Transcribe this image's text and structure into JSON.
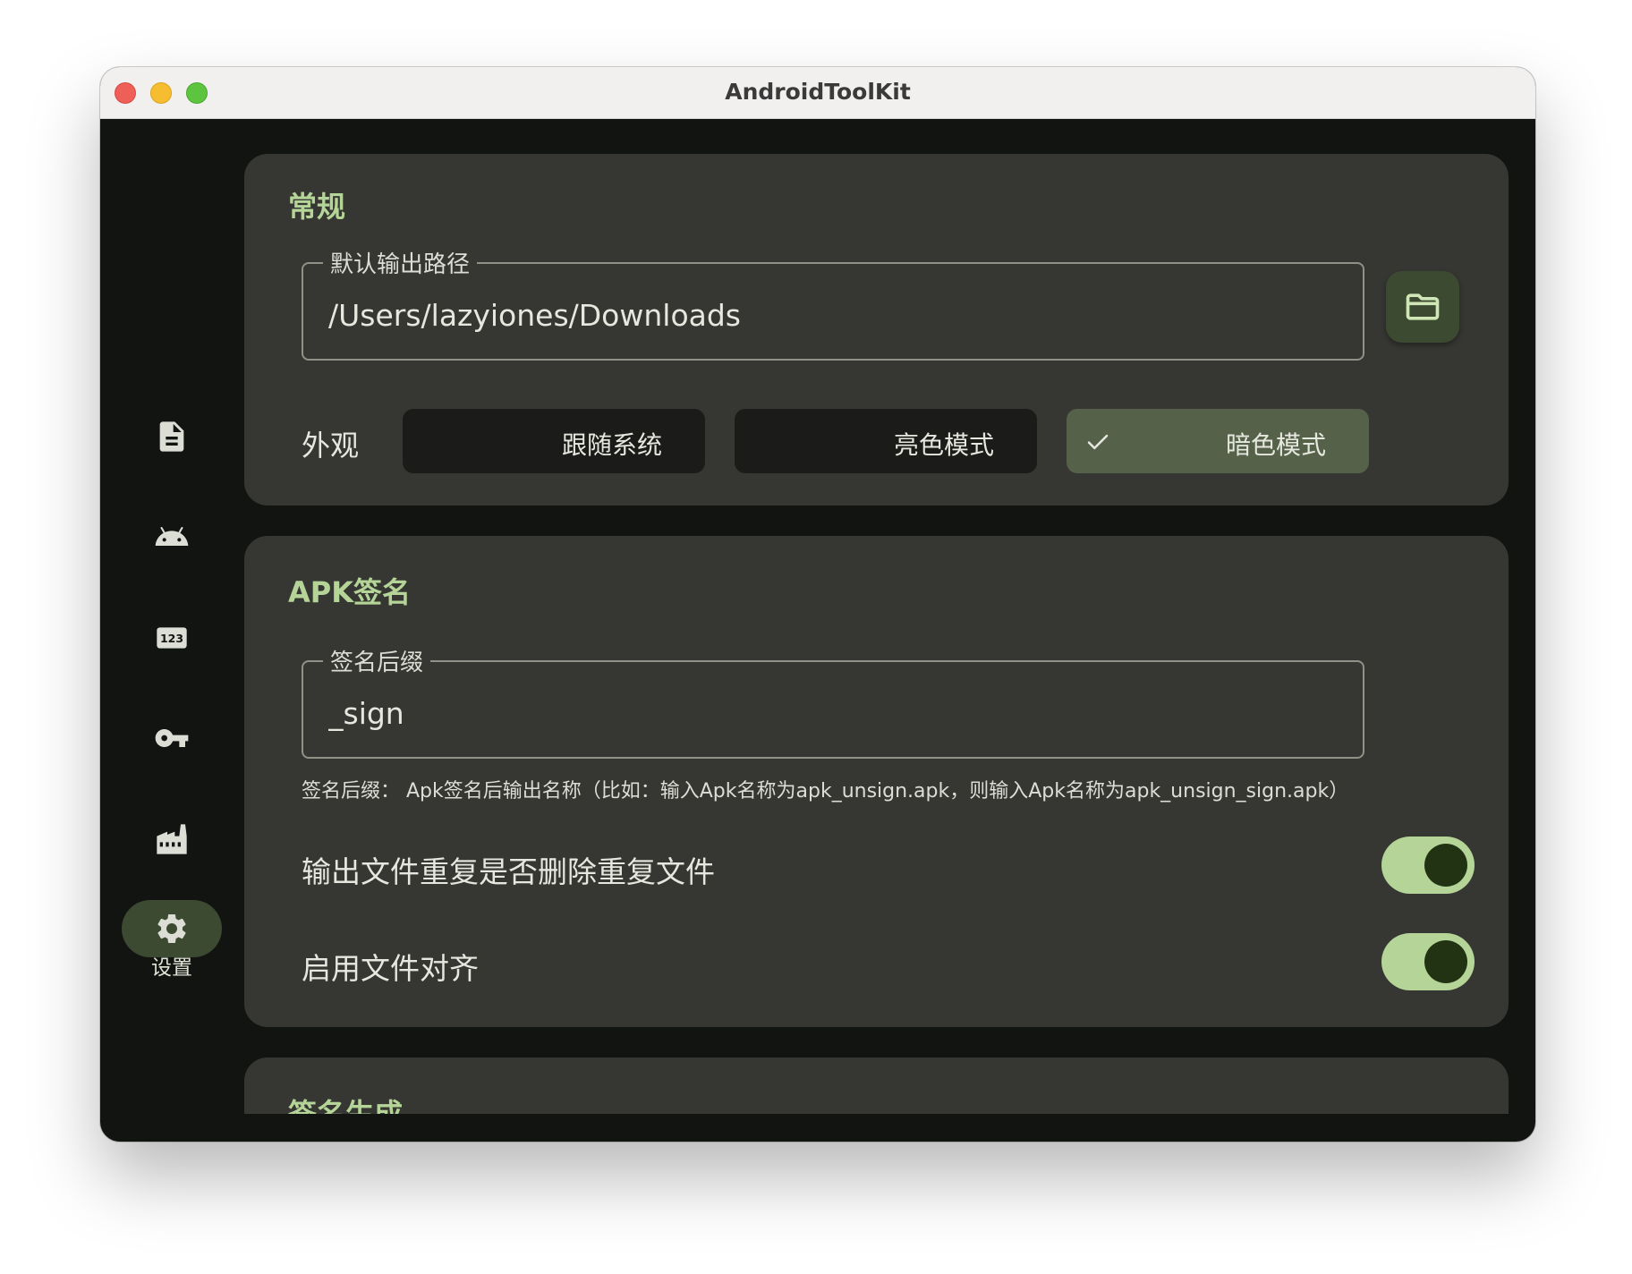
{
  "window": {
    "title": "AndroidToolKit"
  },
  "sidebar": {
    "items": [
      {
        "icon": "document-icon"
      },
      {
        "icon": "android-icon"
      },
      {
        "icon": "numbers-123-icon"
      },
      {
        "icon": "key-icon"
      },
      {
        "icon": "factory-icon"
      },
      {
        "icon": "gear-icon",
        "label": "设置",
        "active": true
      }
    ]
  },
  "general": {
    "title": "常规",
    "output_path": {
      "label": "默认输出路径",
      "value": "/Users/lazyiones/Downloads"
    },
    "folder_button_icon": "folder-icon",
    "appearance": {
      "label": "外观",
      "options": [
        "跟随系统",
        "亮色模式",
        "暗色模式"
      ],
      "selected": "暗色模式"
    }
  },
  "apk_sign": {
    "title": "APK签名",
    "suffix": {
      "label": "签名后缀",
      "value": "_sign"
    },
    "helper": "签名后缀： Apk签名后输出名称（比如：输入Apk名称为apk_unsign.apk，则输入Apk名称为apk_unsign_sign.apk）",
    "settings": [
      {
        "label": "输出文件重复是否删除重复文件",
        "enabled": true
      },
      {
        "label": "启用文件对齐",
        "enabled": true
      }
    ]
  },
  "sign_gen": {
    "title": "签名生成"
  },
  "colors": {
    "accent": "#b5d497",
    "surface": "#363632",
    "background": "#121411",
    "selected_segment": "#56614a",
    "active_nav": "#3c4a31"
  }
}
